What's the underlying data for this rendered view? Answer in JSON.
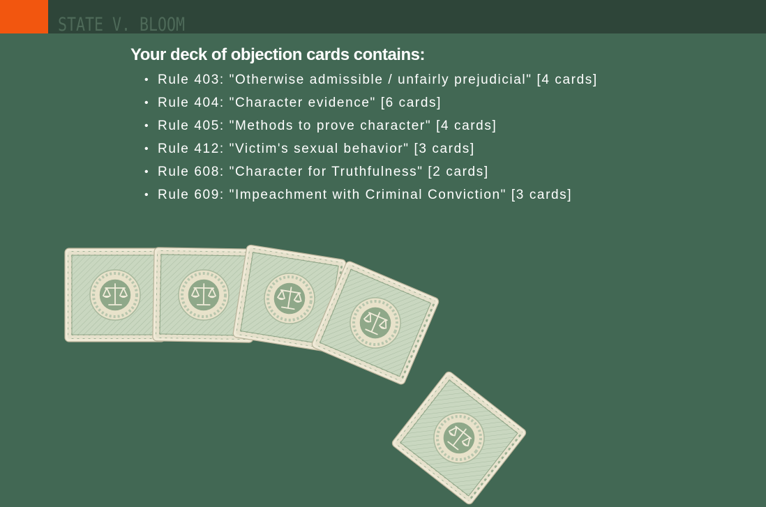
{
  "header": {
    "title": "STATE V. BLOOM"
  },
  "deck": {
    "heading": "Your deck of objection cards contains:",
    "rules": [
      {
        "text": "Rule 403: \"Otherwise admissible / unfairly prejudicial\" [4 cards]"
      },
      {
        "text": "Rule 404: \"Character evidence\" [6 cards]"
      },
      {
        "text": "Rule 405: \"Methods to prove character\" [4 cards]"
      },
      {
        "text": "Rule 412: \"Victim's sexual behavior\" [3 cards]"
      },
      {
        "text": "Rule 608: \"Character for Truthfulness\" [2 cards]"
      },
      {
        "text": "Rule 609: \"Impeachment with Criminal Conviction\" [3 cards]"
      }
    ],
    "card_count_shown": 5,
    "card_back_icon": "scales-of-justice-icon"
  },
  "colors": {
    "background": "#426854",
    "topbar": "#2e4539",
    "accent": "#f2560f",
    "card_face": "#c8d6bf",
    "card_border": "#efe9d6"
  }
}
